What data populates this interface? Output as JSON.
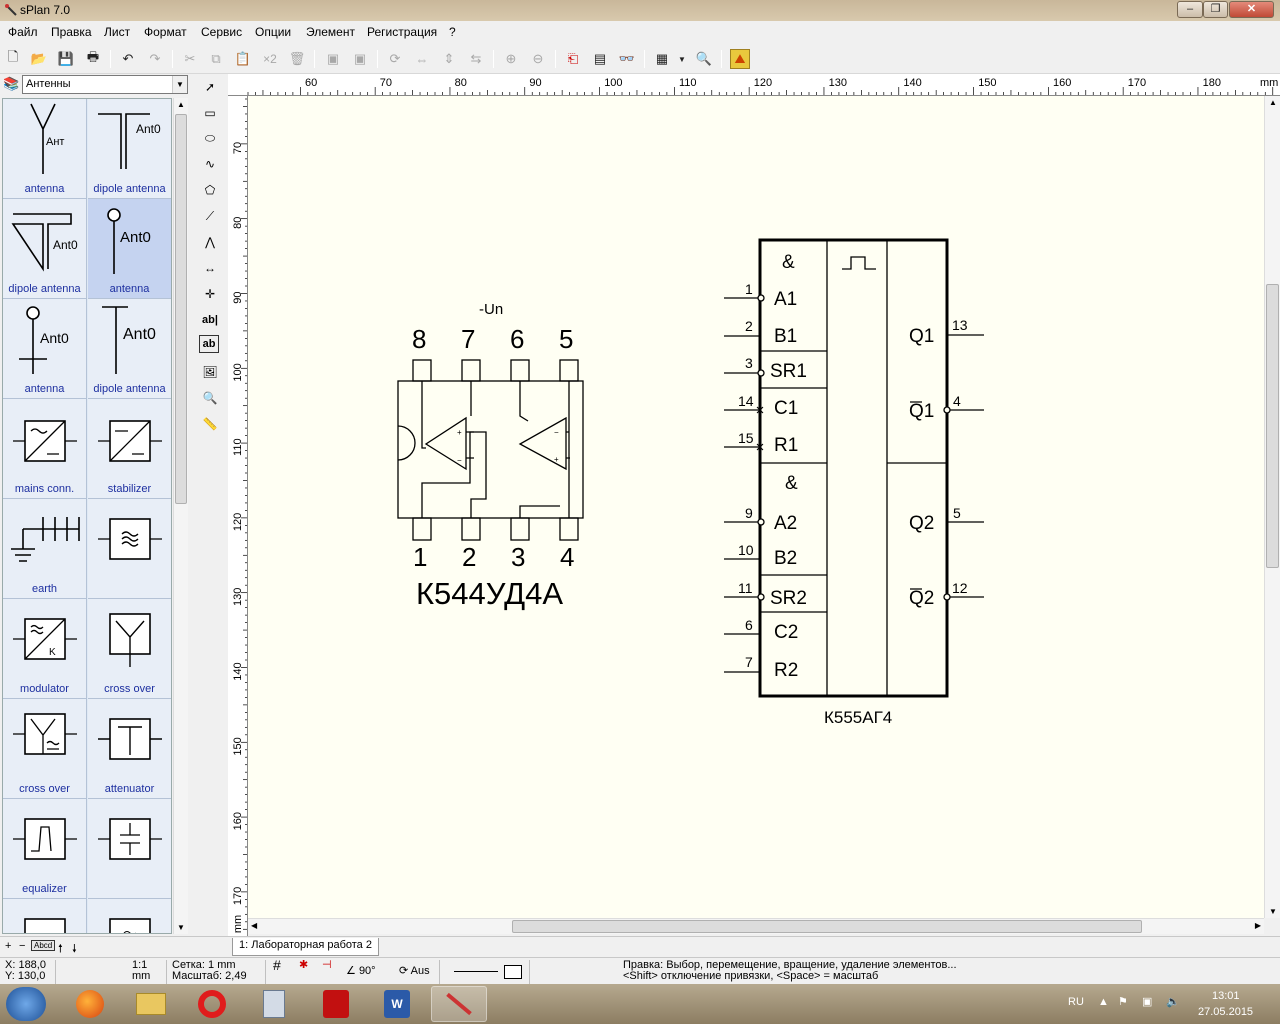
{
  "window": {
    "title": "sPlan 7.0"
  },
  "menu": [
    "Файл",
    "Правка",
    "Лист",
    "Формат",
    "Сервис",
    "Опции",
    "Элемент",
    "Регистрация",
    "?"
  ],
  "toolbar": {
    "duplicate_label": "×2"
  },
  "library": {
    "selected": "Антенны",
    "items": [
      {
        "label": "antenna",
        "symbol_text": "Ант"
      },
      {
        "label": "dipole antenna",
        "symbol_text": "Ant0"
      },
      {
        "label": "dipole antenna",
        "symbol_text": "Ant0"
      },
      {
        "label": "antenna",
        "symbol_text": "Ant0"
      },
      {
        "label": "antenna",
        "symbol_text": "Ant0"
      },
      {
        "label": "dipole antenna",
        "symbol_text": "Ant0"
      },
      {
        "label": "mains conn.",
        "symbol_text": ""
      },
      {
        "label": "stabilizer",
        "symbol_text": ""
      },
      {
        "label": "earth",
        "symbol_text": ""
      },
      {
        "label": "",
        "symbol_text": ""
      },
      {
        "label": "modulator",
        "symbol_text": ""
      },
      {
        "label": "cross over",
        "symbol_text": ""
      },
      {
        "label": "cross over",
        "symbol_text": ""
      },
      {
        "label": "attenuator",
        "symbol_text": ""
      },
      {
        "label": "equalizer",
        "symbol_text": ""
      },
      {
        "label": "",
        "symbol_text": ""
      }
    ]
  },
  "tools": {
    "text_tool_label": "ab|",
    "textbox_tool_label": "ab"
  },
  "ruler": {
    "horizontal": [
      "60",
      "70",
      "80",
      "90",
      "100",
      "110",
      "120",
      "130",
      "140",
      "150",
      "160",
      "170",
      "180",
      "mm"
    ],
    "vertical": [
      "70",
      "80",
      "90",
      "100",
      "110",
      "120",
      "130",
      "140",
      "150",
      "160",
      "170",
      "mm"
    ]
  },
  "schematic": {
    "opamp": {
      "supply_label": "-Un",
      "top_pins": [
        "8",
        "7",
        "6",
        "5"
      ],
      "bottom_pins": [
        "1",
        "2",
        "3",
        "4"
      ],
      "name": "К544УД4А"
    },
    "chip": {
      "name": "К555АГ4",
      "and1": "&",
      "and2": "&",
      "left_pins": [
        {
          "num": "1",
          "label": "A1"
        },
        {
          "num": "2",
          "label": "B1"
        },
        {
          "num": "3",
          "label": "SR1"
        },
        {
          "num": "14",
          "label": "C1"
        },
        {
          "num": "15",
          "label": "R1"
        },
        {
          "num": "9",
          "label": "A2"
        },
        {
          "num": "10",
          "label": "B2"
        },
        {
          "num": "11",
          "label": "SR2"
        },
        {
          "num": "6",
          "label": "C2"
        },
        {
          "num": "7",
          "label": "R2"
        }
      ],
      "right_pins": [
        {
          "num": "13",
          "label": "Q1"
        },
        {
          "num": "4",
          "label": "Q1"
        },
        {
          "num": "5",
          "label": "Q2"
        },
        {
          "num": "12",
          "label": "Q2"
        }
      ]
    }
  },
  "tabs": {
    "page": "1: Лабораторная работа 2",
    "zoom_box": "Abcd"
  },
  "status": {
    "x": "X: 188,0",
    "y": "Y: 130,0",
    "scale_ratio": "1:1",
    "unit": "mm",
    "grid": "Сетка: 1 mm",
    "zoom": "Масштаб:  2,49",
    "angle": "90°",
    "snap": "Aus",
    "hint1": "Правка: Выбор, перемещение, вращение, удаление элементов...",
    "hint2": "<Shift> отключение привязки, <Space> = масштаб"
  },
  "taskbar": {
    "lang": "RU",
    "time": "13:01",
    "date": "27.05.2015"
  }
}
